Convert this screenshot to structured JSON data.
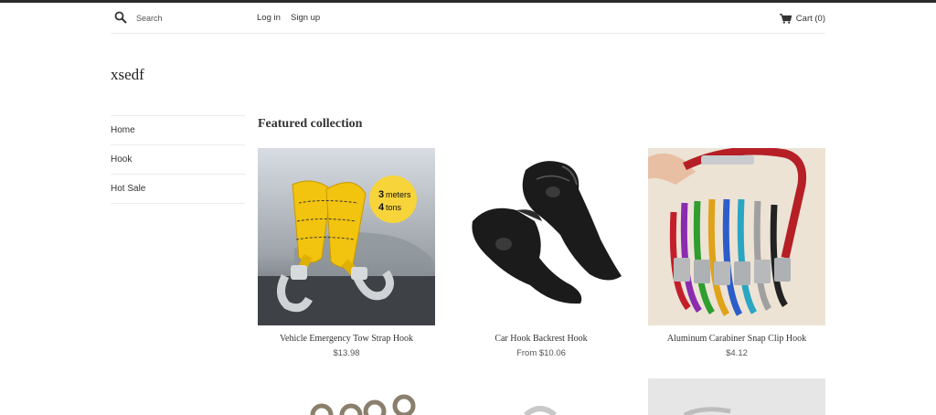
{
  "header": {
    "search_placeholder": "Search",
    "login_label": "Log in",
    "signup_label": "Sign up",
    "cart_label": "Cart (0)"
  },
  "shop": {
    "name": "xsedf"
  },
  "sidebar": {
    "items": [
      {
        "label": "Home"
      },
      {
        "label": "Hook"
      },
      {
        "label": "Hot Sale"
      }
    ]
  },
  "featured": {
    "title": "Featured collection",
    "products": [
      {
        "name": "Vehicle Emergency Tow Strap Hook",
        "price": "$13.98",
        "badge_line1_num": "3",
        "badge_line1_unit": "meters",
        "badge_line2_num": "4",
        "badge_line2_unit": "tons"
      },
      {
        "name": "Car Hook Backrest Hook",
        "price": "From $10.06"
      },
      {
        "name": "Aluminum Carabiner Snap Clip Hook",
        "price": "$4.12"
      }
    ]
  },
  "colors": {
    "topbar": "#2b2b2b",
    "badge": "#f7d43a",
    "strap": "#f2c30f"
  }
}
